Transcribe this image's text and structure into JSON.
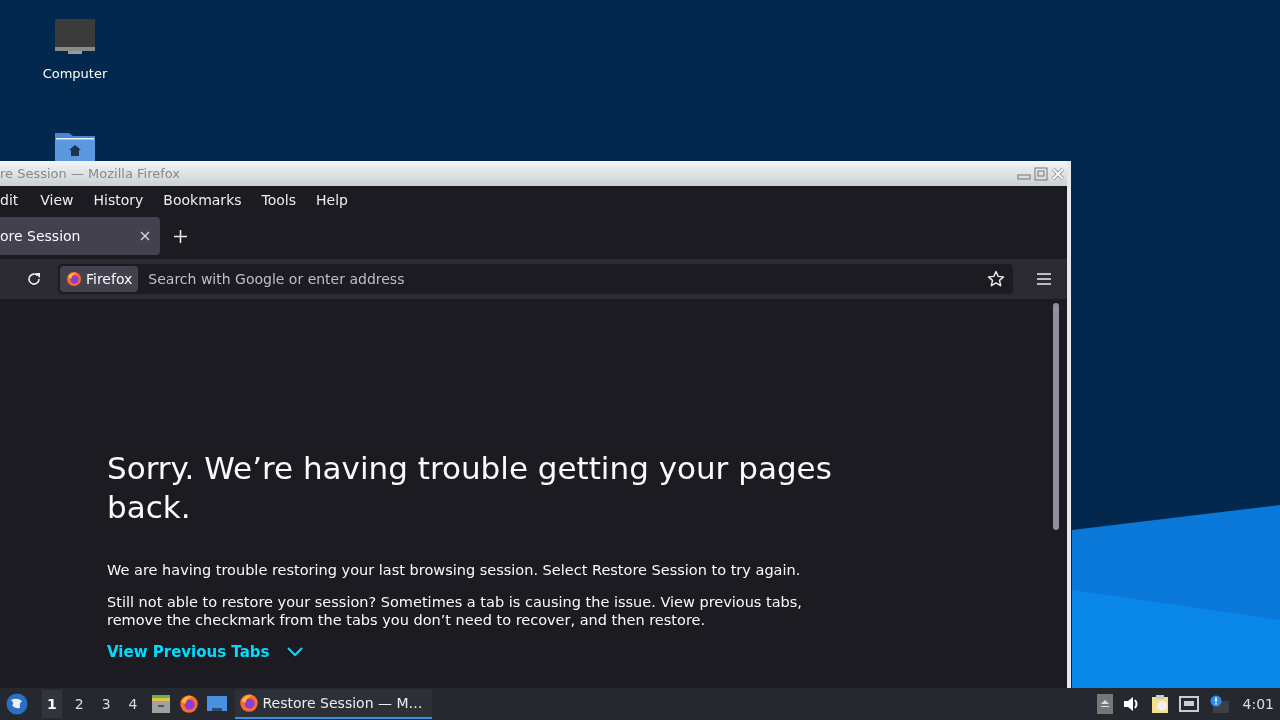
{
  "desktop": {
    "icons": [
      {
        "label": "Computer"
      }
    ]
  },
  "window": {
    "title": "re Session — Mozilla Firefox",
    "menu": [
      "dit",
      "View",
      "History",
      "Bookmarks",
      "Tools",
      "Help"
    ],
    "tabs": [
      {
        "label": "ore Session",
        "selected": true
      }
    ],
    "address_bar": {
      "identity": "Firefox",
      "placeholder": "Search with Google or enter address"
    },
    "page": {
      "heading": "Sorry. We’re having trouble getting your pages back.",
      "paragraphs": [
        "We are having trouble restoring your last browsing session. Select Restore Session to try again.",
        "Still not able to restore your session? Sometimes a tab is causing the issue. View previous tabs, remove the checkmark from the tabs you don’t need to recover, and then restore."
      ],
      "link": "View Previous Tabs",
      "expanded": false
    }
  },
  "taskbar": {
    "workspaces": [
      {
        "label": "1",
        "selected": true
      },
      {
        "label": "2",
        "selected": false
      },
      {
        "label": "3",
        "selected": false
      },
      {
        "label": "4",
        "selected": false
      }
    ],
    "tasks": [
      {
        "label": "Restore Session — M…",
        "selected": true
      }
    ],
    "clock": "4:01"
  }
}
